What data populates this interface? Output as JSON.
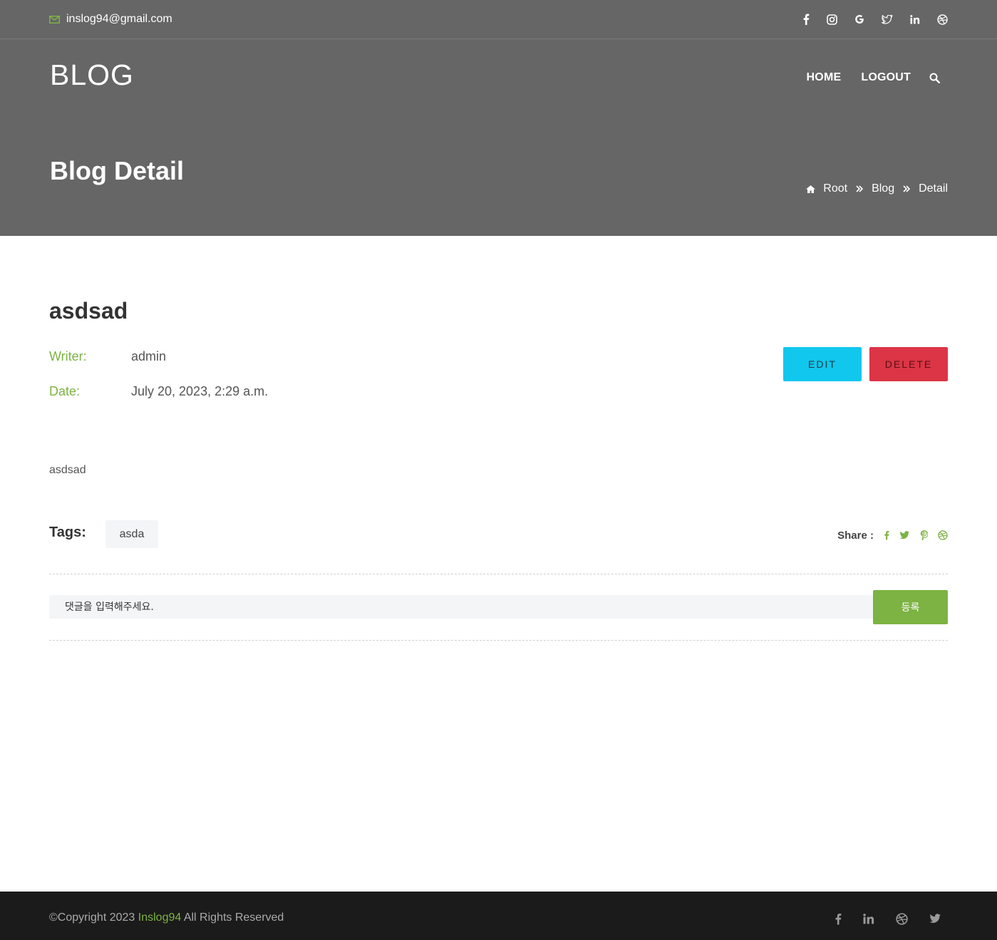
{
  "header": {
    "email": "inslog94@gmail.com",
    "social_icons": [
      "facebook-icon",
      "instagram-icon",
      "google-icon",
      "twitter-icon",
      "linkedin-icon",
      "dribbble-icon"
    ],
    "logo": "BLOG",
    "nav": {
      "home": "HOME",
      "logout": "LOGOUT"
    },
    "page_title": "Blog Detail",
    "breadcrumb": {
      "root": "Root",
      "blog": "Blog",
      "detail": "Detail"
    }
  },
  "post": {
    "title": "asdsad",
    "writer_label": "Writer:",
    "writer": "admin",
    "date_label": "Date:",
    "date": "July 20, 2023, 2:29 a.m.",
    "edit_label": "EDIT",
    "delete_label": "DELETE",
    "content": "asdsad",
    "tags_label": "Tags:",
    "tags": [
      "asda"
    ],
    "share_label": "Share :"
  },
  "comment": {
    "placeholder": "댓글을 입력해주세요.",
    "submit_label": "등록"
  },
  "footer": {
    "copyright_prefix": "©Copyright 2023",
    "brand": "Inslog94",
    "copyright_suffix": "All Rights Reserved"
  },
  "colors": {
    "accent": "#7cb342",
    "header_bg": "#666666",
    "edit_button": "#11c7ee",
    "delete_button": "#dc3545",
    "footer_bg": "#1b1b1b"
  }
}
